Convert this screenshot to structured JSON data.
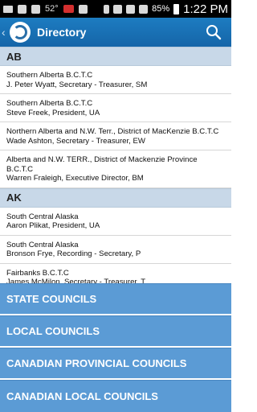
{
  "status_bar": {
    "temperature": "52°",
    "battery": "85%",
    "time": "1:22 PM"
  },
  "action_bar": {
    "title": "Directory",
    "icons": [
      "back-chevron-icon",
      "logo-icon",
      "search-icon"
    ]
  },
  "sections": [
    {
      "header": "AB",
      "items": [
        {
          "name": "Southern Alberta B.C.T.C",
          "detail": "J. Peter Wyatt, Secretary - Treasurer, SM"
        },
        {
          "name": "Southern Alberta B.C.T.C",
          "detail": "Steve Freek, President, UA"
        },
        {
          "name": "Northern Alberta and N.W. Terr., District of MacKenzie B.C.T.C",
          "detail": "Wade Ashton, Secretary - Treasurer, EW"
        },
        {
          "name": "Alberta and N.W. TERR., District of Mackenzie Province B.C.T.C",
          "detail": "Warren Fraleigh, Executive Director, BM"
        }
      ]
    },
    {
      "header": "AK",
      "items": [
        {
          "name": "South Central Alaska",
          "detail": "Aaron Plikat, President, UA"
        },
        {
          "name": "South Central Alaska",
          "detail": "Bronson Frye, Recording - Secretary, P"
        },
        {
          "name": "Fairbanks B.C.T.C",
          "detail": "James McMilon, Secretary - Treasurer, T"
        }
      ]
    }
  ],
  "footer_buttons": [
    "STATE COUNCILS",
    "LOCAL COUNCILS",
    "CANADIAN PROVINCIAL COUNCILS",
    "CANADIAN LOCAL COUNCILS"
  ]
}
